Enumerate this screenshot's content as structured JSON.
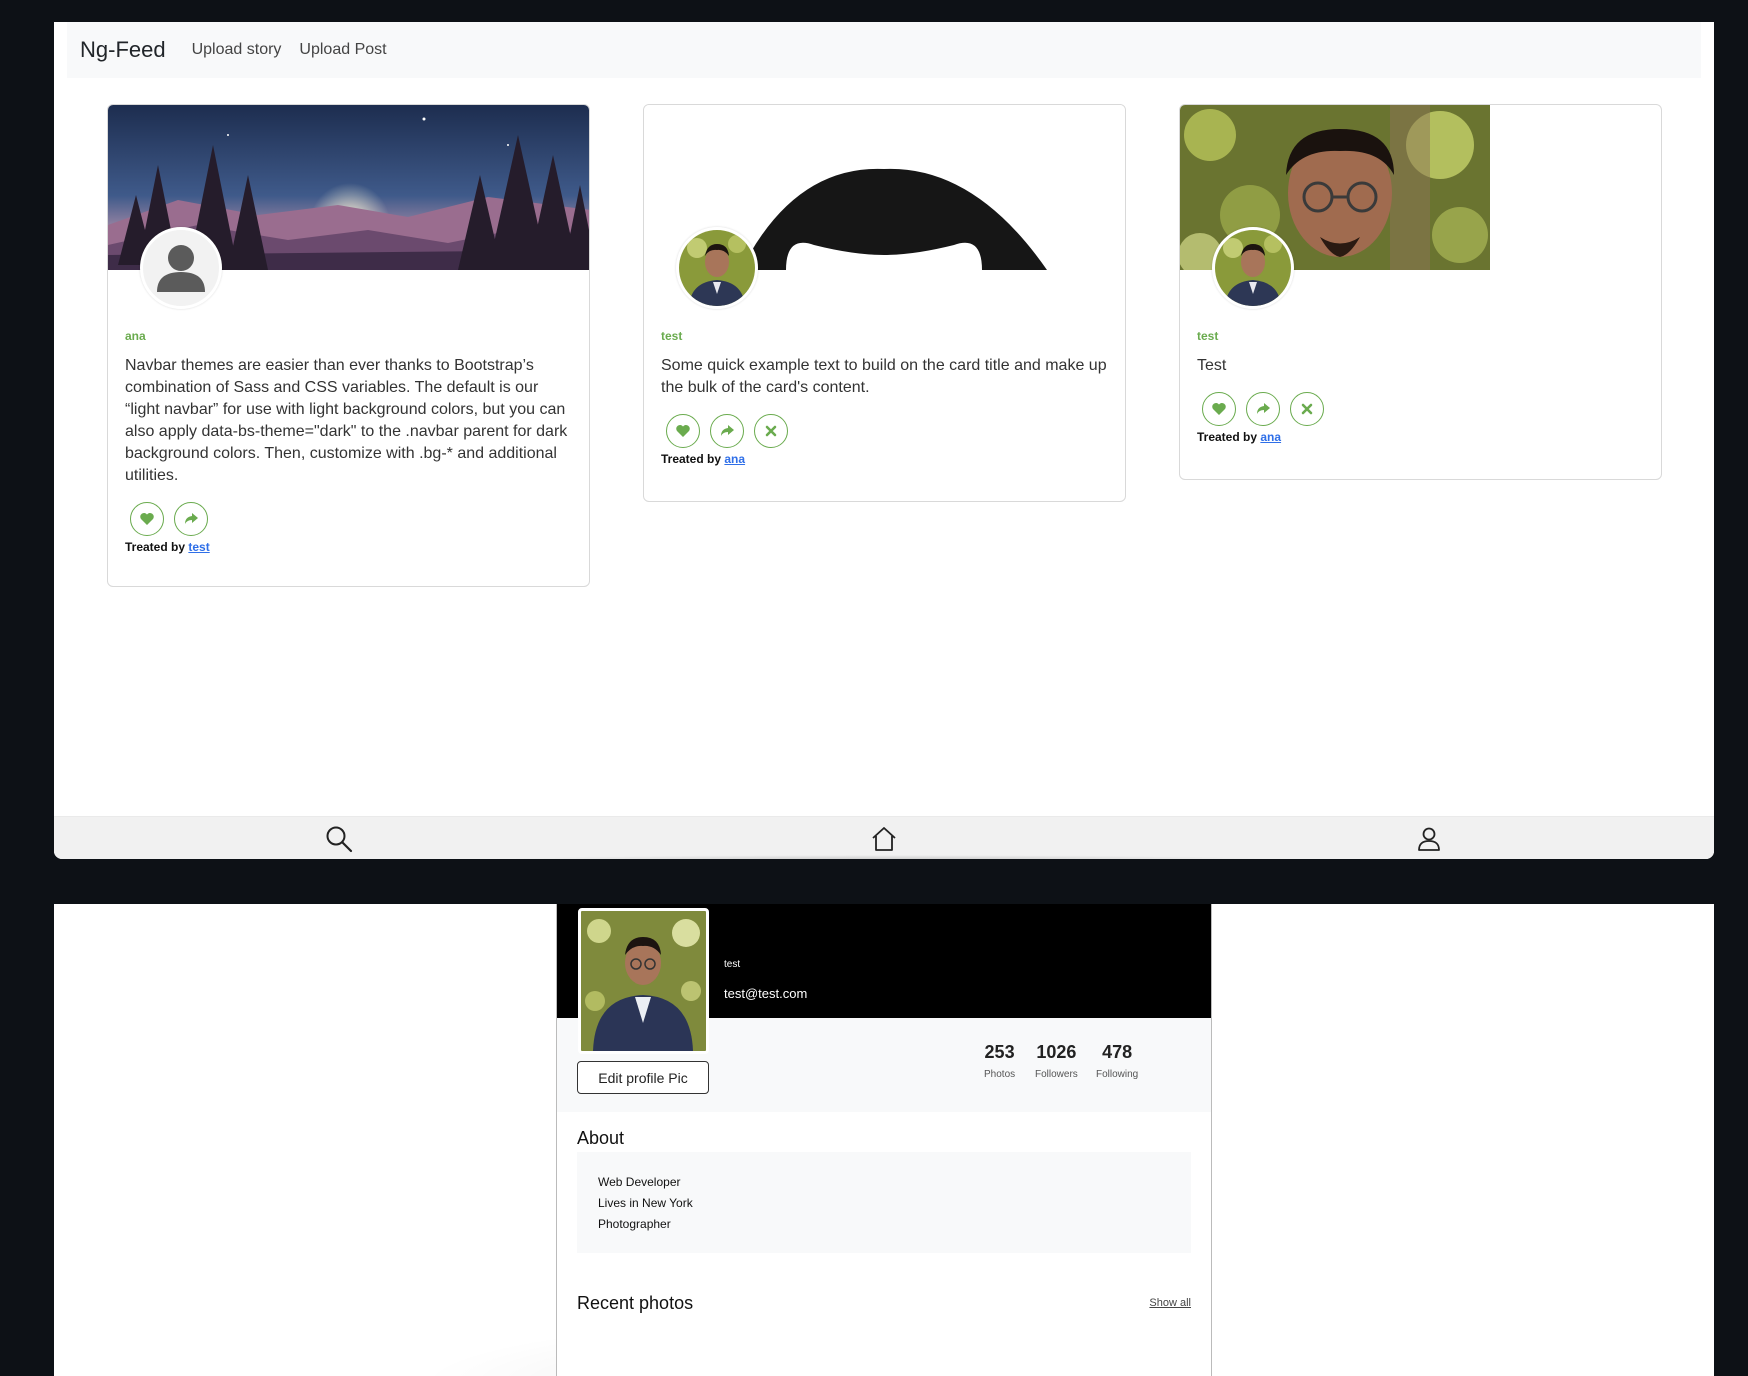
{
  "navbar": {
    "brand": "Ng-Feed",
    "links": [
      "Upload story",
      "Upload Post"
    ]
  },
  "cards": [
    {
      "user": "ana",
      "text": "Navbar themes are easier than ever thanks to Bootstrap’s combination of Sass and CSS variables. The default is our “light navbar” for use with light background colors, but you can also apply data-bs-theme=\"dark\" to the .navbar parent for dark background colors. Then, customize with .bg-* and additional utilities.",
      "treated_label": "Treated by",
      "treated_by": "test",
      "actions": [
        "heart-icon",
        "share-icon"
      ]
    },
    {
      "user": "test",
      "text": "Some quick example text to build on the card title and make up the bulk of the card's content.",
      "treated_label": "Treated by",
      "treated_by": "ana",
      "actions": [
        "heart-icon",
        "share-icon",
        "close-icon"
      ]
    },
    {
      "user": "test",
      "text": "Test",
      "treated_label": "Treated by",
      "treated_by": "ana",
      "actions": [
        "heart-icon",
        "share-icon",
        "close-icon"
      ]
    }
  ],
  "bottom_nav": [
    "search-icon",
    "home-icon",
    "user-icon"
  ],
  "profile": {
    "name": "test",
    "email": "test@test.com",
    "edit_button": "Edit profile Pic",
    "stats": [
      {
        "value": "253",
        "label": "Photos"
      },
      {
        "value": "1026",
        "label": "Followers"
      },
      {
        "value": "478",
        "label": "Following"
      }
    ],
    "about_title": "About",
    "about_items": [
      "Web Developer",
      "Lives in New York",
      "Photographer"
    ],
    "recent_title": "Recent photos",
    "show_all": "Show all"
  },
  "colors": {
    "accent": "#6aab4e",
    "link": "#2f6fe8",
    "frame": "#0d1116"
  }
}
